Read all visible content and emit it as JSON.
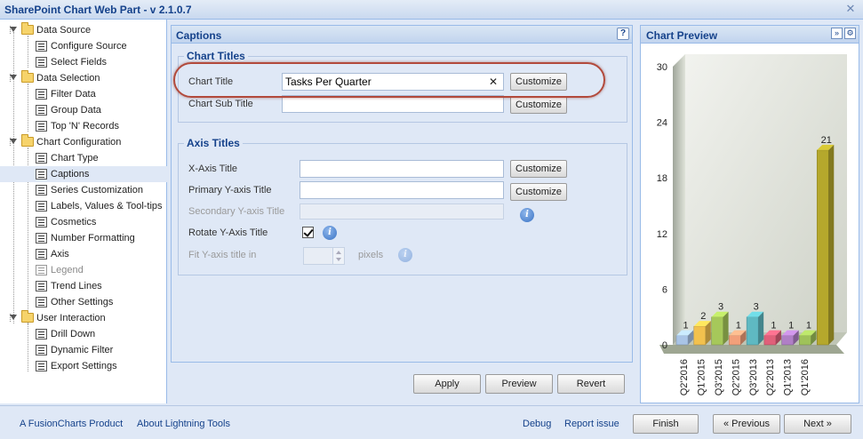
{
  "window": {
    "title": "SharePoint Chart Web Part - v 2.1.0.7",
    "close_symbol": "✕"
  },
  "tree": {
    "folders": [
      {
        "label": "Data Source"
      },
      {
        "label": "Data Selection"
      },
      {
        "label": "Chart Configuration"
      },
      {
        "label": "User Interaction"
      }
    ],
    "leaves": [
      {
        "label": "Configure Source"
      },
      {
        "label": "Select Fields"
      },
      {
        "label": "Filter Data"
      },
      {
        "label": "Group Data"
      },
      {
        "label": "Top 'N' Records"
      },
      {
        "label": "Chart Type"
      },
      {
        "label": "Captions"
      },
      {
        "label": "Series Customization"
      },
      {
        "label": "Labels, Values & Tool-tips"
      },
      {
        "label": "Cosmetics"
      },
      {
        "label": "Number Formatting"
      },
      {
        "label": "Axis"
      },
      {
        "label": "Legend"
      },
      {
        "label": "Trend Lines"
      },
      {
        "label": "Other Settings"
      },
      {
        "label": "Drill Down"
      },
      {
        "label": "Dynamic Filter"
      },
      {
        "label": "Export Settings"
      }
    ]
  },
  "captions": {
    "title": "Captions",
    "help_symbol": "?",
    "chart_titles": {
      "legend": "Chart Titles",
      "chart_title_label": "Chart Title",
      "chart_title_value": "Tasks Per Quarter",
      "chart_subtitle_label": "Chart Sub Title",
      "chart_subtitle_value": "",
      "customize_label": "Customize"
    },
    "axis_titles": {
      "legend": "Axis Titles",
      "x_axis_label": "X-Axis Title",
      "x_axis_value": "",
      "primary_y_label": "Primary Y-axis Title",
      "primary_y_value": "",
      "secondary_y_label": "Secondary Y-axis Title",
      "secondary_y_value": "",
      "rotate_label": "Rotate Y-Axis Title",
      "rotate_checked": true,
      "fit_label": "Fit Y-axis title in",
      "fit_value": "",
      "pixels_label": "pixels",
      "customize_label": "Customize",
      "info_symbol": "i"
    },
    "buttons": {
      "apply": "Apply",
      "preview": "Preview",
      "revert": "Revert"
    }
  },
  "preview": {
    "title": "Chart Preview",
    "expand_symbol": "»",
    "settings_symbol": "⚙",
    "chart_data": {
      "type": "bar",
      "categories": [
        "Q2'2016",
        "Q1'2015",
        "Q3'2015",
        "Q2'2015",
        "Q3'2013",
        "Q2'2013",
        "Q1'2013",
        "Q1'2016"
      ],
      "values": [
        1,
        2,
        3,
        1,
        3,
        1,
        1,
        1,
        1,
        21
      ],
      "bars": [
        {
          "value": 1,
          "color": "#a9c4e6"
        },
        {
          "value": 2,
          "color": "#f2c14e"
        },
        {
          "value": 3,
          "color": "#a6c85a"
        },
        {
          "value": 1,
          "color": "#f2a07a"
        },
        {
          "value": 3,
          "color": "#5fb9c2"
        },
        {
          "value": 1,
          "color": "#e0607a"
        },
        {
          "value": 1,
          "color": "#b07fc6"
        },
        {
          "value": 1,
          "color": "#9fc25a"
        },
        {
          "value": 21,
          "color": "#b5a82c"
        }
      ],
      "ylim": [
        0,
        30
      ],
      "yticks": [
        0,
        6,
        12,
        18,
        24,
        30
      ],
      "title": "",
      "xlabel": "",
      "ylabel": ""
    }
  },
  "footer": {
    "fusioncharts": "A FusionCharts Product",
    "about": "About Lightning Tools",
    "debug": "Debug",
    "report": "Report issue",
    "finish": "Finish",
    "previous": "« Previous",
    "next": "Next »"
  }
}
